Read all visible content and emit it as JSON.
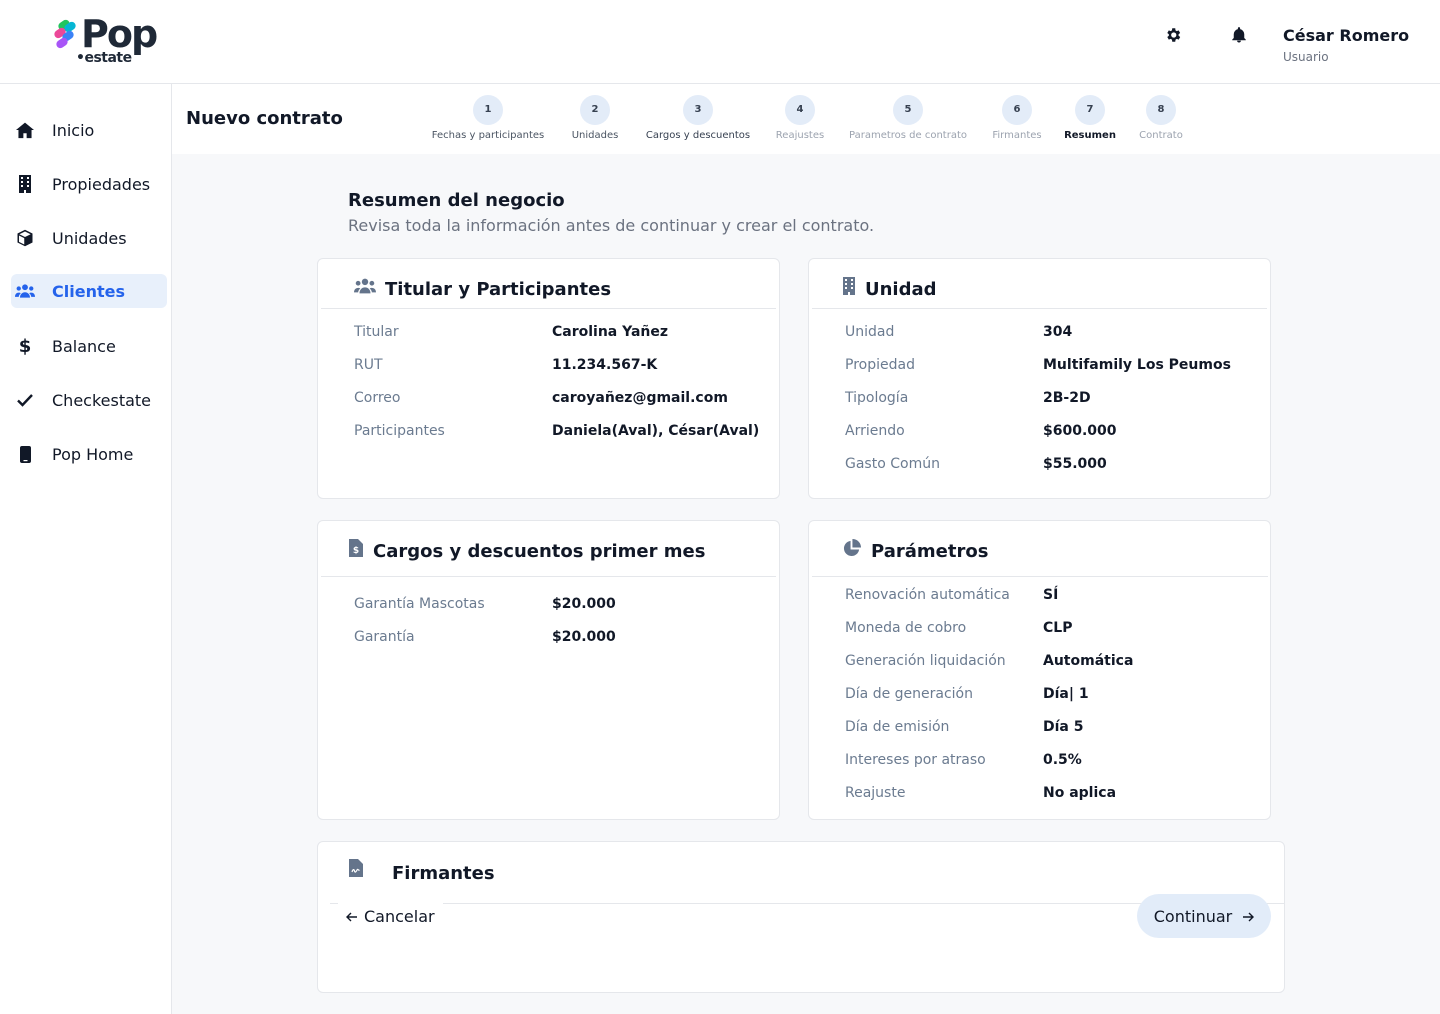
{
  "brand": {
    "name": "Pop",
    "sub": "estate"
  },
  "user": {
    "name": "César Romero",
    "role": "Usuario"
  },
  "header_icons": [
    "gear-icon",
    "bell-icon"
  ],
  "sidebar": {
    "items": [
      {
        "label": "Inicio",
        "icon": "home-icon",
        "active": false
      },
      {
        "label": "Propiedades",
        "icon": "building-icon",
        "active": false
      },
      {
        "label": "Unidades",
        "icon": "cube-icon",
        "active": false
      },
      {
        "label": "Clientes",
        "icon": "users-icon",
        "active": true
      },
      {
        "label": "Balance",
        "icon": "dollar-icon",
        "active": false
      },
      {
        "label": "Checkestate",
        "icon": "check-icon",
        "active": false
      },
      {
        "label": "Pop Home",
        "icon": "phone-icon",
        "active": false
      }
    ]
  },
  "page": {
    "title": "Nuevo contrato"
  },
  "stepper": {
    "current": 7,
    "steps": [
      {
        "number": "1",
        "label": "Fechas y participantes"
      },
      {
        "number": "2",
        "label": "Unidades"
      },
      {
        "number": "3",
        "label": "Cargos y descuentos"
      },
      {
        "number": "4",
        "label": "Reajustes"
      },
      {
        "number": "5",
        "label": "Parametros de contrato"
      },
      {
        "number": "6",
        "label": "Firmantes"
      },
      {
        "number": "7",
        "label": "Resumen"
      },
      {
        "number": "8",
        "label": "Contrato"
      }
    ]
  },
  "summary": {
    "title": "Resumen del negocio",
    "subtitle": "Revisa toda la información antes de continuar y crear el contrato."
  },
  "titular": {
    "title": "Titular y Participantes",
    "rows": [
      {
        "label": "Titular",
        "value": "Carolina Yañez"
      },
      {
        "label": "RUT",
        "value": "11.234.567-K"
      },
      {
        "label": "Correo",
        "value": "caroyañez@gmail.com"
      },
      {
        "label": "Participantes",
        "value": "Daniela(Aval), César(Aval)"
      }
    ]
  },
  "unidad": {
    "title": "Unidad",
    "rows": [
      {
        "label": "Unidad",
        "value": "304"
      },
      {
        "label": "Propiedad",
        "value": "Multifamily Los Peumos"
      },
      {
        "label": "Tipología",
        "value": "2B-2D"
      },
      {
        "label": "Arriendo",
        "value": "$600.000"
      },
      {
        "label": "Gasto Común",
        "value": "$55.000"
      }
    ]
  },
  "cargos": {
    "title": "Cargos  y descuentos primer mes",
    "rows": [
      {
        "label": "Garantía Mascotas",
        "value": "$20.000"
      },
      {
        "label": "Garantía",
        "value": "$20.000"
      }
    ]
  },
  "parametros": {
    "title": "Parámetros",
    "rows": [
      {
        "label": "Renovación automática",
        "value": "SÍ"
      },
      {
        "label": "Moneda de cobro",
        "value": "CLP"
      },
      {
        "label": "Generación liquidación",
        "value": "Automática"
      },
      {
        "label": "Día de generación",
        "value": "Día| 1"
      },
      {
        "label": "Día de emisión",
        "value": "Día 5"
      },
      {
        "label": "Intereses por atraso",
        "value": "0.5%"
      },
      {
        "label": "Reajuste",
        "value": "No aplica"
      }
    ]
  },
  "firmantes": {
    "title": "Firmantes"
  },
  "actions": {
    "cancel": "Cancelar",
    "continue": "Continuar"
  }
}
